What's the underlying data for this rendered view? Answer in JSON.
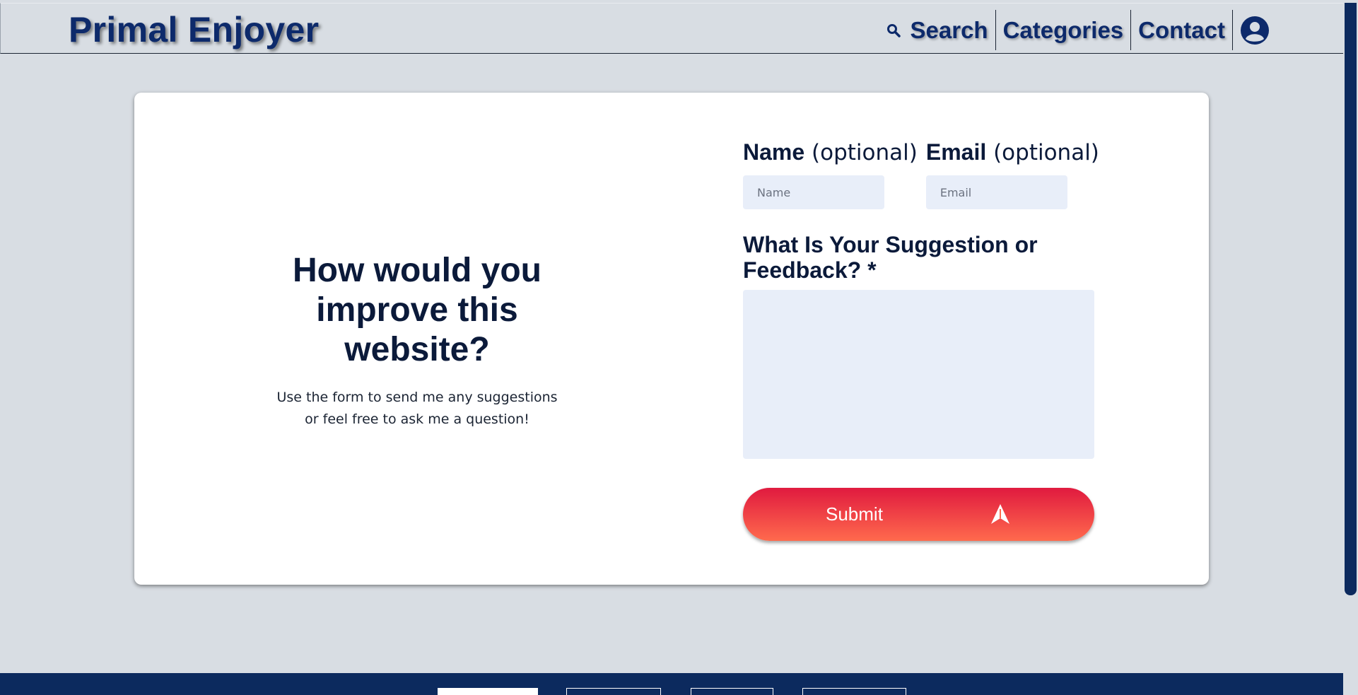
{
  "header": {
    "logo": "Primal Enjoyer",
    "nav": {
      "search": "Search",
      "categories": "Categories",
      "contact": "Contact"
    }
  },
  "left": {
    "title": "How would you improve this website?",
    "subtitle": "Use the form to send me any suggestions or feel free to ask me a question!"
  },
  "form": {
    "name_label": "Name",
    "name_optional": "(optional)",
    "name_placeholder": "Name",
    "email_label": "Email",
    "email_optional": "(optional)",
    "email_placeholder": "Email",
    "feedback_label": "What Is Your Suggestion or Feedback? *",
    "feedback_value": "",
    "submit_label": "Submit"
  },
  "colors": {
    "brand_navy": "#0c2a5e",
    "background": "#d8dde3",
    "input_fill": "#e8eef9",
    "submit_gradient_top": "#e01a3f",
    "submit_gradient_bottom": "#ff6a4d"
  },
  "icons": {
    "search": "search-icon",
    "account": "user-circle-icon",
    "submit": "send-arrow-icon"
  }
}
